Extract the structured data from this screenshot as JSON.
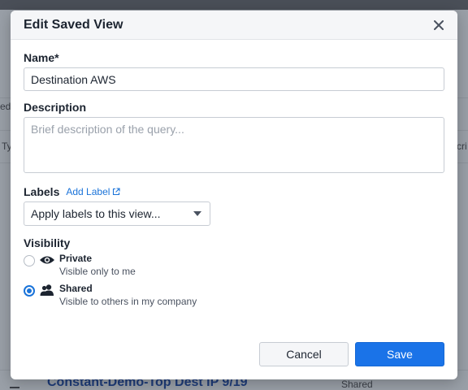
{
  "background": {
    "fragments": [
      "ed",
      "Ty",
      "cri"
    ],
    "row_link": "Constant-Demo-Top Dest IP 9/19",
    "row_visibility": "Shared"
  },
  "modal": {
    "title": "Edit Saved View",
    "close_icon": "close-icon",
    "name": {
      "label": "Name*",
      "value": "Destination AWS"
    },
    "description": {
      "label": "Description",
      "value": "",
      "placeholder": "Brief description of the query..."
    },
    "labels": {
      "label": "Labels",
      "add_link": "Add Label",
      "select_value": "Apply labels to this view..."
    },
    "visibility": {
      "label": "Visibility",
      "options": [
        {
          "title": "Private",
          "description": "Visible only to me",
          "icon": "eye-icon",
          "selected": false
        },
        {
          "title": "Shared",
          "description": "Visible to others in my company",
          "icon": "users-icon",
          "selected": true
        }
      ]
    },
    "buttons": {
      "cancel": "Cancel",
      "save": "Save"
    }
  },
  "colors": {
    "accent": "#1a73e8",
    "link": "#1a73d9",
    "text": "#1c2430"
  }
}
